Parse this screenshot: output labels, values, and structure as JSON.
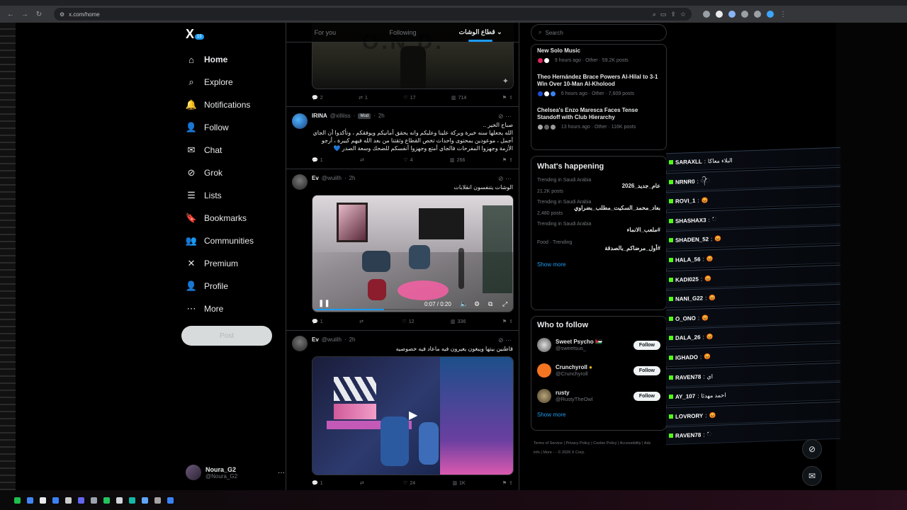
{
  "browser": {
    "url": "x.com/home"
  },
  "sidebar": {
    "logo": "X",
    "items": [
      {
        "label": "Home",
        "icon": "home-icon",
        "glyph": "⌂"
      },
      {
        "label": "Explore",
        "icon": "search-icon",
        "glyph": "⌕"
      },
      {
        "label": "Notifications",
        "icon": "bell-icon",
        "glyph": "🔔",
        "badge": "15"
      },
      {
        "label": "Follow",
        "icon": "person-add-icon",
        "glyph": "👤"
      },
      {
        "label": "Chat",
        "icon": "mail-icon",
        "glyph": "✉"
      },
      {
        "label": "Grok",
        "icon": "grok-icon",
        "glyph": "⊘"
      },
      {
        "label": "Lists",
        "icon": "list-icon",
        "glyph": "☰"
      },
      {
        "label": "Bookmarks",
        "icon": "bookmark-icon",
        "glyph": "🔖"
      },
      {
        "label": "Communities",
        "icon": "communities-icon",
        "glyph": "👥"
      },
      {
        "label": "Premium",
        "icon": "x-icon",
        "glyph": "✕"
      },
      {
        "label": "Profile",
        "icon": "profile-icon",
        "glyph": "👤"
      },
      {
        "label": "More",
        "icon": "more-circle-icon",
        "glyph": "⋯"
      }
    ],
    "post_label": "Post",
    "account": {
      "name": "Noura_G2",
      "handle": "@Noura_G2"
    }
  },
  "timeline": {
    "tabs": [
      "For you",
      "Following",
      "قطاع الوشات"
    ],
    "tweets": [
      {
        "replies": "2",
        "retweets": "1",
        "likes": "17",
        "views": "714"
      },
      {
        "name": "IRINA",
        "handle": "@xilliiss",
        "badge": "Mod",
        "time": "2h",
        "text_lines": [
          "صباح الخير ..",
          "الله يجعلها سنه خيرة وبركة علينا وعليكم وانه يحقق أمانيكم ويوفقكم ، وتأكدوا أن الجاي",
          "أجمل ، موعودين بمحتوى واحداث تخص القطاع وثقتنا من بعد الله فيهم كبيرة ، أرجو",
          "الأزمة وجهزوا المفرحات فالجاي أمتع وجهزوا أنفسكم للضحك وسعة الصدر 💙"
        ],
        "replies": "1",
        "retweets": "",
        "likes": "4",
        "views": "266"
      },
      {
        "name": "Ev",
        "handle": "@wuiilh",
        "time": "2h",
        "text": "الوشات يتنفسون انقلابات",
        "video_time": "0:07 / 0:20",
        "replies": "1",
        "retweets": "",
        "likes": "12",
        "views": "336"
      },
      {
        "name": "Ev",
        "handle": "@wuiilh",
        "time": "2h",
        "text": "قاطنين بيتها ويبغون يغيرون فيه ماعاد فيه خصوصيه",
        "replies": "1",
        "retweets": "",
        "likes": "24",
        "views": "1K"
      }
    ]
  },
  "rightcol": {
    "search_placeholder": "Search",
    "news": [
      {
        "title": "New Solo Music",
        "meta": "9 hours ago · Other · 59.2K posts"
      },
      {
        "title": "Theo Hernández Brace Powers Al-Hilal to 3-1 Win Over 10-Man Al-Kholood",
        "meta": "6 hours ago · Other · 7,609 posts"
      },
      {
        "title": "Chelsea's Enzo Maresca Faces Tense Standoff with Club Hierarchy",
        "meta": "13 hours ago · Other · 116K posts"
      }
    ],
    "happening_title": "What's happening",
    "trends": [
      {
        "context": "Trending in Saudi Arabia",
        "name": "عام_جديد_2026",
        "posts": "21.2K posts"
      },
      {
        "context": "Trending in Saudi Arabia",
        "name": "بعاد_محمد_السكيت_مطلب_بضراوي",
        "posts": "2,480 posts"
      },
      {
        "context": "Trending in Saudi Arabia",
        "name": "#ملعب_الانماء",
        "posts": ""
      },
      {
        "context": "Food · Trending",
        "name": "#أول_مرضاكم_بالصدقة",
        "posts": ""
      }
    ],
    "show_more": "Show more",
    "wtf_title": "Who to follow",
    "wtf": [
      {
        "name": "Sweet Psycho 🇯🇴",
        "handle": "@sweetsus_",
        "btn": "Follow"
      },
      {
        "name": "Crunchyroll",
        "handle": "@Crunchyroll",
        "btn": "Follow"
      },
      {
        "name": "rusty",
        "handle": "@RustyTheOwl",
        "btn": "Follow"
      }
    ],
    "wtf_more": "Show more",
    "footer": "Terms of Service  |  Privacy Policy  |  Cookie Policy  |  Accessibility  |  Ads info  |  More ···  © 2026 X Corp."
  },
  "chat": [
    {
      "user": "SARAXLL",
      "msg": "البلاء معاكا",
      "wave": false
    },
    {
      "user": "NRNR0",
      "msg": "᭄ᨗᨗᨗᨗᨗᨗᨗᨗᨗᨗᨗᨗᨗᨗᨗᨗᨗᨗᨗᨗᨗᨗ",
      "wave": true
    },
    {
      "user": "ROVI_1",
      "msg": "😡",
      "wave": false
    },
    {
      "user": "SHASHAX3",
      "msg": "ᨗᨗᨗᨗᨗᨗᨗᨗᨗᨗᨗᨗᨗᨗᨗᨗᨗᨗᨗᨗᨗᨗᨗᨗᨗᨗᨗᨗᨗᨗᨗᨗᨗᨗᨗᨗᨗᨗᨗ",
      "wave": true
    },
    {
      "user": "SHADEN_52",
      "msg": "😡",
      "wave": false
    },
    {
      "user": "HALA_56",
      "msg": "😡",
      "wave": false
    },
    {
      "user": "KADI025",
      "msg": "😡",
      "wave": false
    },
    {
      "user": "NANI_G22",
      "msg": "😡",
      "wave": false
    },
    {
      "user": "O_ONO",
      "msg": "😡",
      "wave": false
    },
    {
      "user": "DALA_26",
      "msg": "😡",
      "wave": false
    },
    {
      "user": "IGHADO",
      "msg": "😡",
      "wave": false
    },
    {
      "user": "RAVEN78",
      "msg": "اي",
      "wave": false
    },
    {
      "user": "AY_107",
      "msg": "احمد مهدئا",
      "wave": false
    },
    {
      "user": "LOVRORY",
      "msg": "😡",
      "wave": false
    },
    {
      "user": "RAVEN78",
      "msg": "ᨗᨗᨗᨗᨗᨗᨗᨗᨗᨗᨗᨗᨗᨗᨗᨗᨗᨗᨗᨗᨗᨗᨗᨗᨗᨗᨗᨗᨗᨗᨗᨗᨗᨗᨗᨗᨗᨗᨗᨗ",
      "wave": true
    }
  ],
  "colors": {
    "accent": "#1d9bf0",
    "bg": "#000000",
    "border": "#2f3336",
    "muted": "#71767b",
    "kick_green": "#53fc18"
  }
}
